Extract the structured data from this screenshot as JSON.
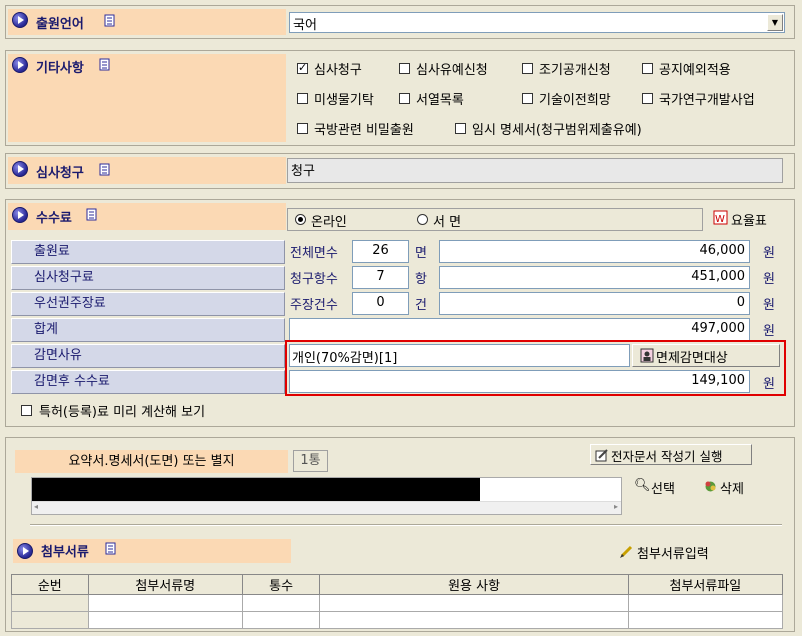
{
  "applicant_language": {
    "title": "출원언어",
    "value": "국어"
  },
  "other_items": {
    "title": "기타사항",
    "options": [
      {
        "label": "심사청구",
        "checked": true
      },
      {
        "label": "심사유예신청",
        "checked": false
      },
      {
        "label": "조기공개신청",
        "checked": false
      },
      {
        "label": "공지예외적용",
        "checked": false
      },
      {
        "label": "미생물기탁",
        "checked": false
      },
      {
        "label": "서열목록",
        "checked": false
      },
      {
        "label": "기술이전희망",
        "checked": false
      },
      {
        "label": "국가연구개발사업",
        "checked": false
      },
      {
        "label": "국방관련 비밀출원",
        "checked": false
      },
      {
        "label": "임시 명세서(청구범위제출유예)",
        "checked": false
      }
    ]
  },
  "exam_request": {
    "title": "심사청구",
    "value": "청구"
  },
  "fees": {
    "title": "수수료",
    "radio_online": "온라인",
    "radio_paper": "서  면",
    "fee_table_label": "요율표",
    "rows": [
      {
        "label": "출원료",
        "sub_label": "전체면수",
        "count": "26",
        "unit": "면",
        "amount": "46,000",
        "currency": "원"
      },
      {
        "label": "심사청구료",
        "sub_label": "청구항수",
        "count": "7",
        "unit": "항",
        "amount": "451,000",
        "currency": "원"
      },
      {
        "label": "우선권주장료",
        "sub_label": "주장건수",
        "count": "0",
        "unit": "건",
        "amount": "0",
        "currency": "원"
      }
    ],
    "total_label": "합계",
    "total_amount": "497,000",
    "total_currency": "원",
    "reduction_reason_label": "감면사유",
    "reduction_reason_value": "개인(70%감면)[1]",
    "exemption_button": "면제감면대상",
    "after_reduction_label": "감면후 수수료",
    "after_reduction_amount": "149,100",
    "after_reduction_currency": "원",
    "preview_checkbox": "특허(등록)료 미리 계산해 보기"
  },
  "documents": {
    "summary_label": "요약서.명세서(도면) 또는 별지",
    "copies": "1통",
    "editor_button": "전자문서 작성기 실행",
    "select_button": "선택",
    "delete_button": "삭제"
  },
  "attachments": {
    "title": "첨부서류",
    "input_button": "첨부서류입력",
    "columns": [
      "순번",
      "첨부서류명",
      "통수",
      "원용 사항",
      "첨부서류파일"
    ]
  },
  "colors": {
    "highlight_border": "#e00000",
    "title_text": "#1a1a6e",
    "section_bg": "#fbd9b4"
  }
}
